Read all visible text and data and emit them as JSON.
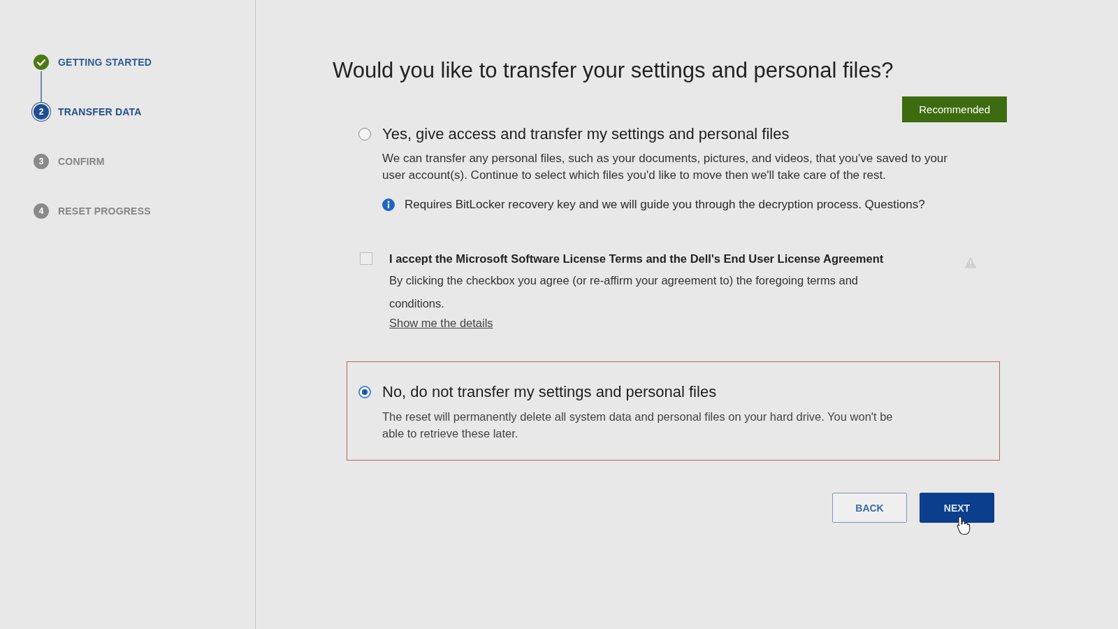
{
  "sidebar": {
    "steps": [
      {
        "label": "GETTING STARTED",
        "completed": true,
        "selected": false
      },
      {
        "number": "2",
        "label": "TRANSFER DATA",
        "completed": false,
        "selected": true
      },
      {
        "number": "3",
        "label": "CONFIRM",
        "completed": false,
        "selected": false
      },
      {
        "number": "4",
        "label": "RESET PROGRESS",
        "completed": false,
        "selected": false
      }
    ]
  },
  "main": {
    "title": "Would you like to transfer your settings and personal files?",
    "options": [
      {
        "title": "Yes, give access and transfer my settings and personal files",
        "selected": false,
        "badge": "Recommended",
        "description": "We can transfer any personal files, such as your documents, pictures, and videos, that you've saved to your user account(s). Continue to select which files you'd like to move then we'll take care of the rest.",
        "note": "Requires BitLocker recovery key and we will guide you through the decryption process. Questions?",
        "agreement": {
          "label": "I accept the Microsoft Software License Terms and the Dell's End User License Agreement",
          "checked": false,
          "text": "By clicking the checkbox you agree (or re-affirm your agreement to) the foregoing terms and conditions.",
          "link": "Show me the details"
        }
      },
      {
        "title": "No, do not transfer my settings and personal files",
        "selected": true,
        "description": "The reset will permanently delete all system data and personal files on your hard drive. You won't be able to retrieve these later."
      }
    ]
  },
  "buttons": [
    {
      "label": "BACK",
      "kind": "secondary"
    },
    {
      "label": "NEXT",
      "kind": "primary"
    }
  ]
}
